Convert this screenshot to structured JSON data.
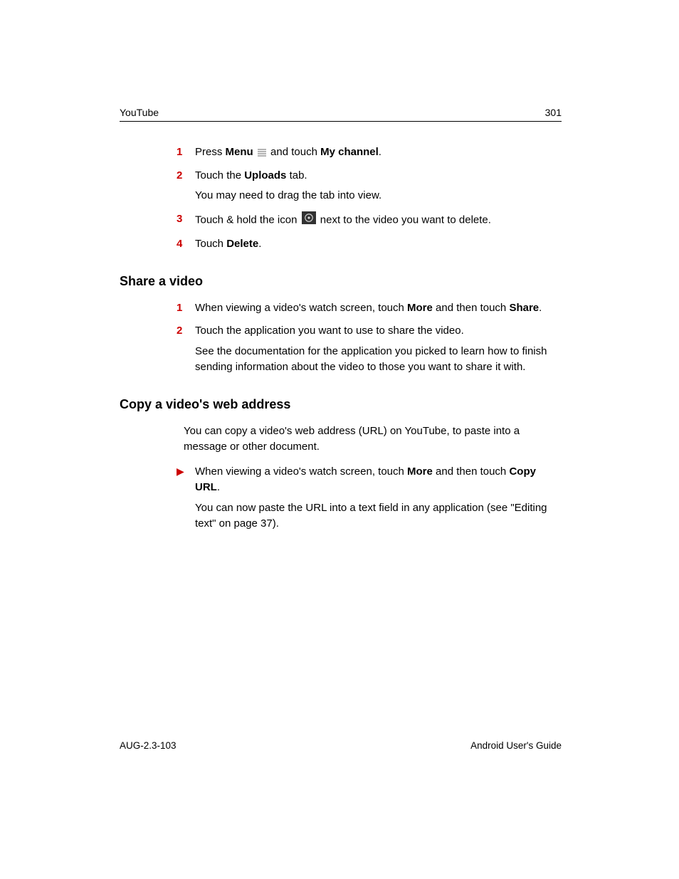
{
  "header": {
    "left": "YouTube",
    "right": "301"
  },
  "section1": {
    "steps": [
      {
        "num": "1",
        "parts": [
          "Press ",
          "Menu",
          " ",
          "ICON_MENU",
          " and touch ",
          "My channel",
          "."
        ]
      },
      {
        "num": "2",
        "parts": [
          "Touch the ",
          "Uploads",
          " tab."
        ],
        "sub": "You may need to drag the tab into view."
      },
      {
        "num": "3",
        "parts": [
          "Touch & hold the icon ",
          "ICON_DISC",
          " next to the video you want to delete."
        ]
      },
      {
        "num": "4",
        "parts": [
          "Touch ",
          "Delete",
          "."
        ]
      }
    ]
  },
  "section2": {
    "heading": "Share a video",
    "steps": [
      {
        "num": "1",
        "parts": [
          "When viewing a video's watch screen, touch ",
          "More",
          " and then touch ",
          "Share",
          "."
        ]
      },
      {
        "num": "2",
        "parts": [
          "Touch the application you want to use to share the video."
        ],
        "sub": "See the documentation for the application you picked to learn how to finish sending information about the video to those you want to share it with."
      }
    ]
  },
  "section3": {
    "heading": "Copy a video's web address",
    "intro": "You can copy a video's web address (URL) on YouTube, to paste into a message or other document.",
    "steps": [
      {
        "num": "▶",
        "parts": [
          "When viewing a video's watch screen, touch ",
          "More",
          " and then touch ",
          "Copy URL",
          "."
        ],
        "sub": "You can now paste the URL into a text field in any application (see \"Editing text\" on page 37)."
      }
    ]
  },
  "footer": {
    "left": "AUG-2.3-103",
    "right": "Android User's Guide"
  },
  "boldWords": [
    "Menu",
    "My channel",
    "Uploads",
    "Delete",
    "More",
    "Share",
    "Copy URL"
  ]
}
